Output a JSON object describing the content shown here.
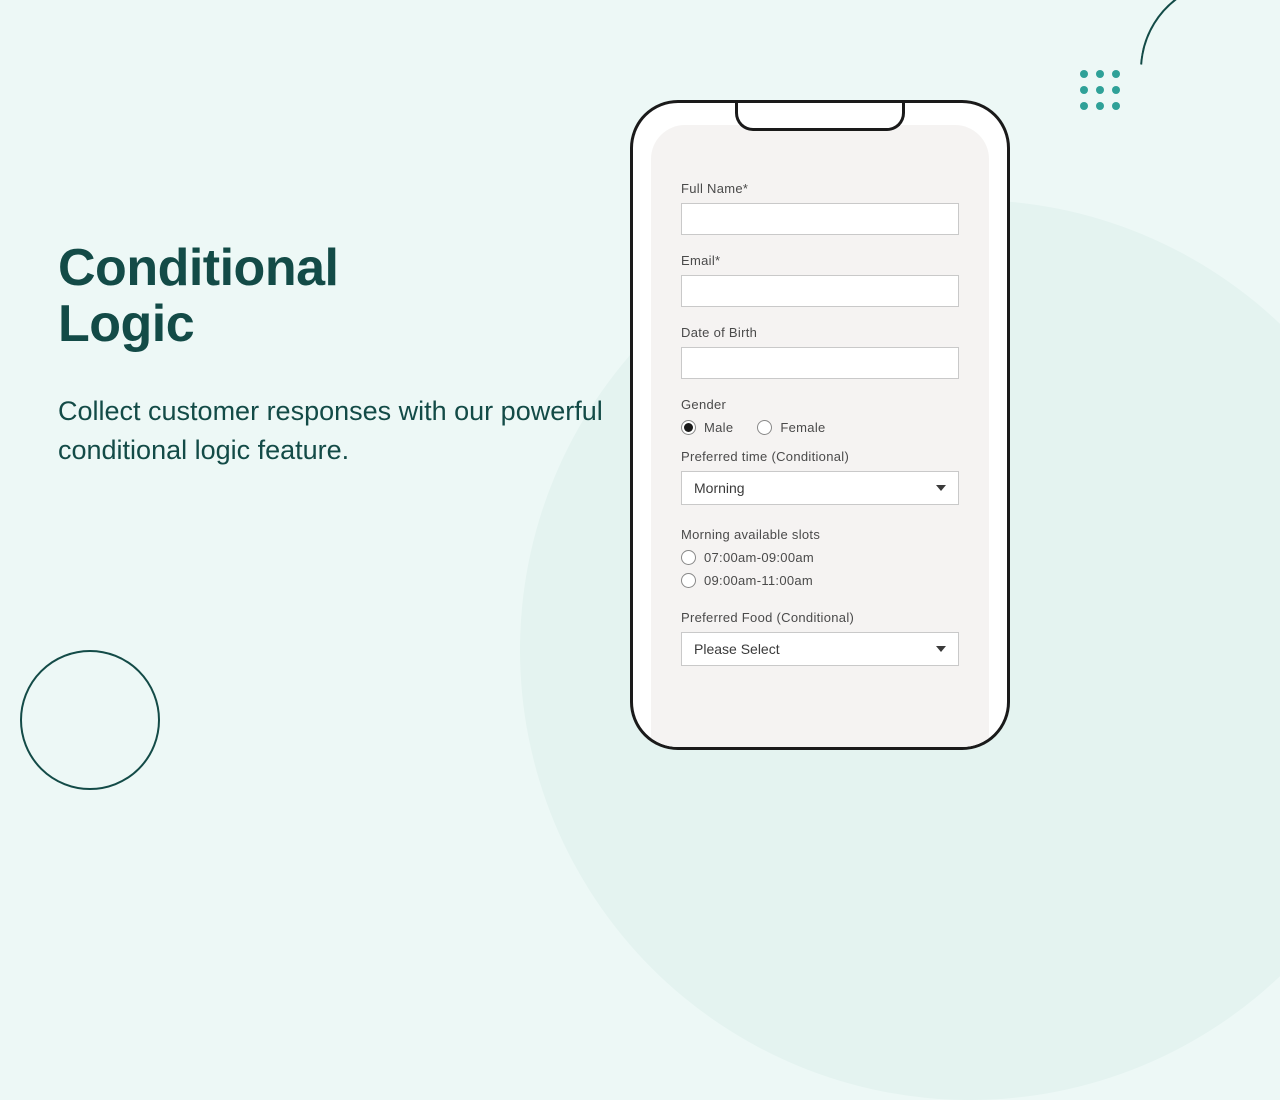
{
  "hero": {
    "title_line1": "Conditional",
    "title_line2": "Logic",
    "subtitle": "Collect customer responses with our powerful conditional logic feature."
  },
  "form": {
    "full_name": {
      "label": "Full Name*",
      "value": ""
    },
    "email": {
      "label": "Email*",
      "value": ""
    },
    "dob": {
      "label": "Date of Birth",
      "value": ""
    },
    "gender": {
      "label": "Gender",
      "options": [
        {
          "label": "Male",
          "selected": true
        },
        {
          "label": "Female",
          "selected": false
        }
      ]
    },
    "preferred_time": {
      "label": "Preferred time (Conditional)",
      "value": "Morning"
    },
    "morning_slots": {
      "label": "Morning available slots",
      "options": [
        {
          "label": "07:00am-09:00am",
          "selected": false
        },
        {
          "label": "09:00am-11:00am",
          "selected": false
        }
      ]
    },
    "preferred_food": {
      "label": "Preferred Food (Conditional)",
      "value": "Please Select"
    }
  },
  "colors": {
    "brand_dark": "#134b47",
    "brand_accent": "#2fa198",
    "bg": "#edf8f6"
  }
}
